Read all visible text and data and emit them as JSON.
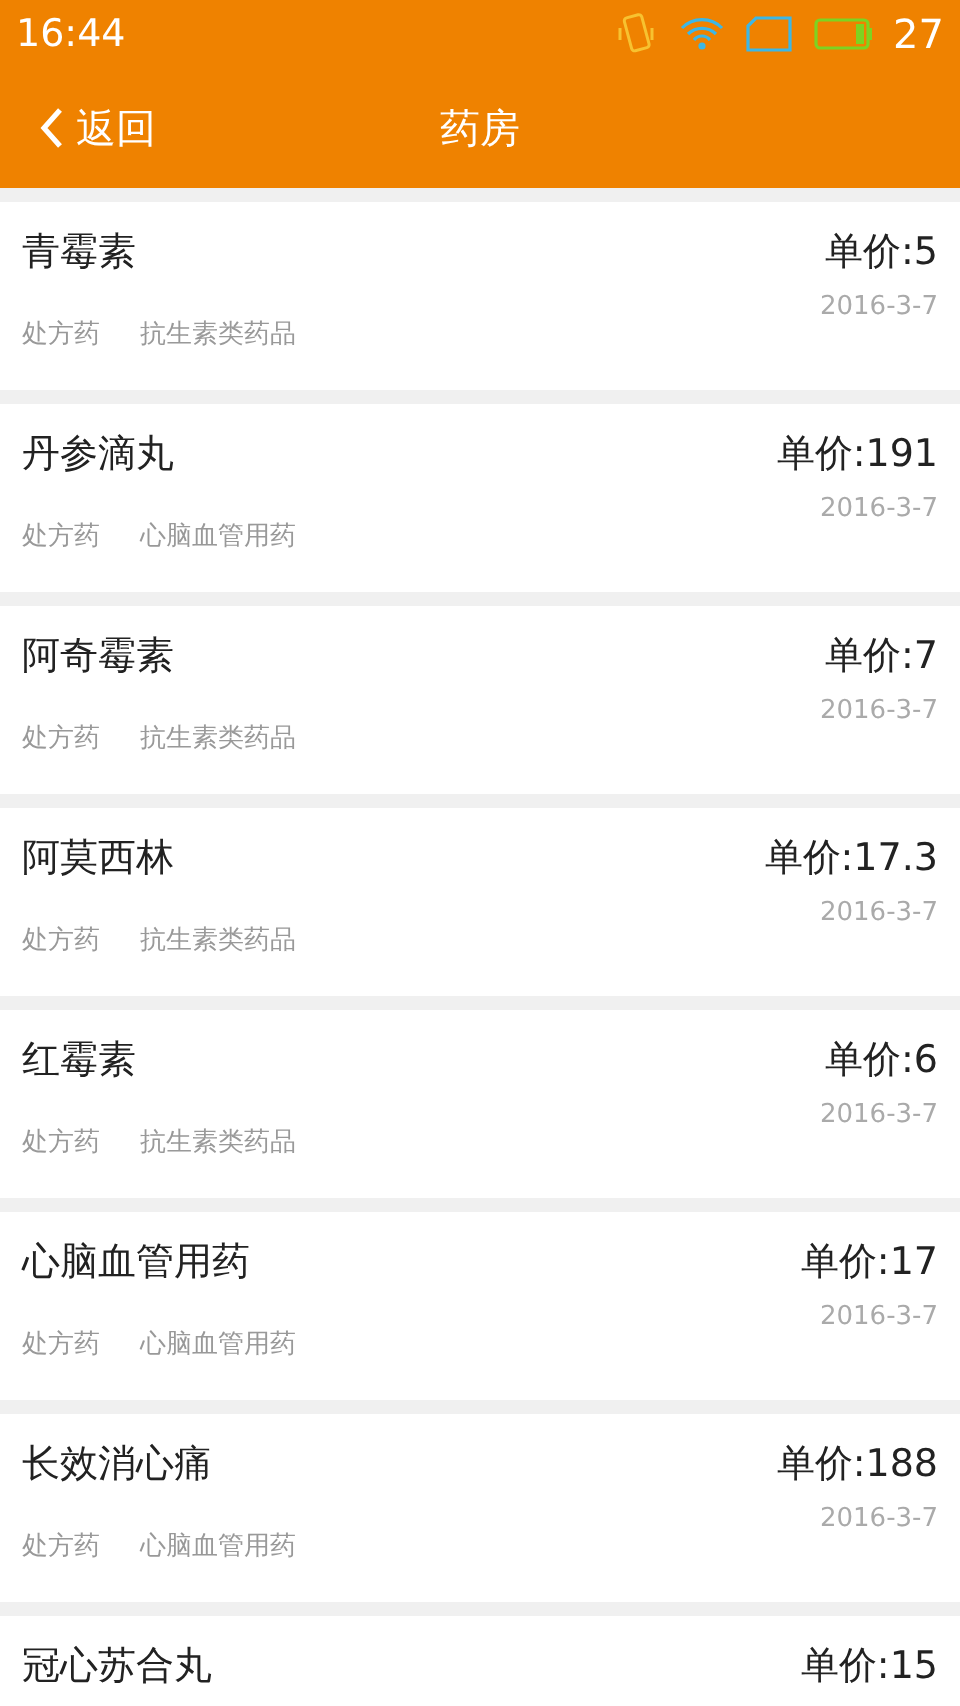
{
  "status_bar": {
    "time": "16:44",
    "battery": "27"
  },
  "header": {
    "back": "返回",
    "title": "药房"
  },
  "drugs": [
    {
      "name": "青霉素",
      "price": "单价:5",
      "type": "处方药",
      "category": "抗生素类药品",
      "date": "2016-3-7"
    },
    {
      "name": "丹参滴丸",
      "price": "单价:191",
      "type": "处方药",
      "category": "心脑血管用药",
      "date": "2016-3-7"
    },
    {
      "name": "阿奇霉素",
      "price": "单价:7",
      "type": "处方药",
      "category": "抗生素类药品",
      "date": "2016-3-7"
    },
    {
      "name": "阿莫西林",
      "price": "单价:17.3",
      "type": "处方药",
      "category": "抗生素类药品",
      "date": "2016-3-7"
    },
    {
      "name": "红霉素",
      "price": "单价:6",
      "type": "处方药",
      "category": "抗生素类药品",
      "date": "2016-3-7"
    },
    {
      "name": "心脑血管用药",
      "price": "单价:17",
      "type": "处方药",
      "category": "心脑血管用药",
      "date": "2016-3-7"
    },
    {
      "name": "长效消心痛",
      "price": "单价:188",
      "type": "处方药",
      "category": "心脑血管用药",
      "date": "2016-3-7"
    },
    {
      "name": "冠心苏合丸",
      "price": "单价:15"
    }
  ]
}
